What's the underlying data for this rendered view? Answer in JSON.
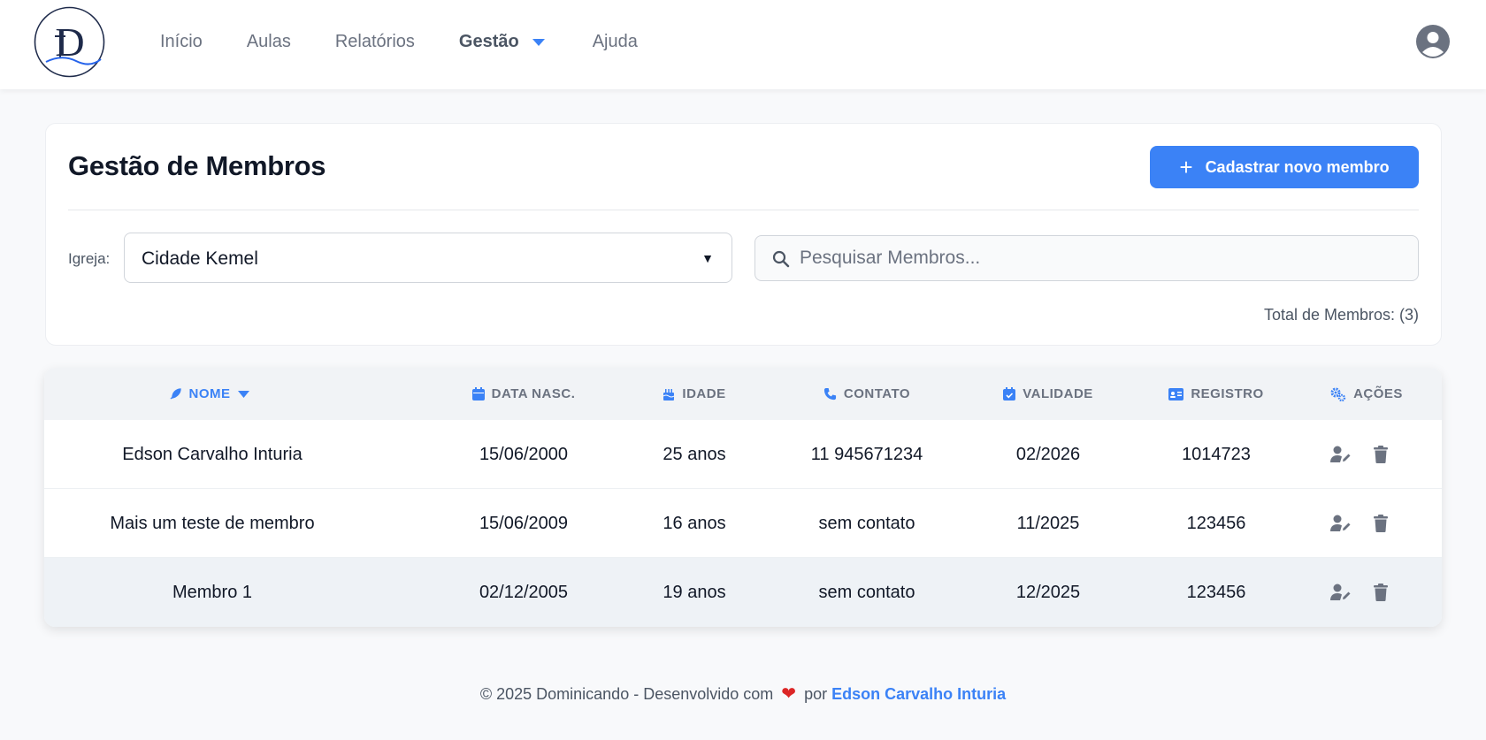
{
  "nav": {
    "items": [
      {
        "label": "Início"
      },
      {
        "label": "Aulas"
      },
      {
        "label": "Relatórios"
      },
      {
        "label": "Gestão"
      },
      {
        "label": "Ajuda"
      }
    ],
    "active_index": 3
  },
  "page": {
    "title": "Gestão de Membros",
    "add_button_label": "Cadastrar novo membro",
    "church_label": "Igreja:",
    "church_selected": "Cidade Kemel",
    "search_placeholder": "Pesquisar Membros...",
    "search_value": "",
    "total_label": "Total de Membros: (3)"
  },
  "table": {
    "columns": [
      {
        "label": "NOME",
        "icon": "feather-icon",
        "sorted": true
      },
      {
        "label": "DATA NASC.",
        "icon": "calendar-icon"
      },
      {
        "label": "IDADE",
        "icon": "cake-icon"
      },
      {
        "label": "CONTATO",
        "icon": "phone-icon"
      },
      {
        "label": "VALIDADE",
        "icon": "calendar-check-icon"
      },
      {
        "label": "REGISTRO",
        "icon": "id-card-icon"
      },
      {
        "label": "AÇÕES",
        "icon": "gears-icon"
      }
    ],
    "rows": [
      {
        "nome": "Edson Carvalho Inturia",
        "nascimento": "15/06/2000",
        "idade": "25 anos",
        "contato": "11 945671234",
        "validade": "02/2026",
        "registro": "1014723"
      },
      {
        "nome": "Mais um teste de membro",
        "nascimento": "15/06/2009",
        "idade": "16 anos",
        "contato": "sem contato",
        "validade": "11/2025",
        "registro": "123456"
      },
      {
        "nome": "Membro 1",
        "nascimento": "02/12/2005",
        "idade": "19 anos",
        "contato": "sem contato",
        "validade": "12/2025",
        "registro": "123456"
      }
    ]
  },
  "footer": {
    "prefix": "© 2025 Dominicando - Desenvolvido com",
    "heart": "❤",
    "middle": "por",
    "author": "Edson Carvalho Inturia"
  },
  "colors": {
    "accent": "#3b82f6",
    "heart": "#dc2626",
    "logo": "#1e2a4a"
  }
}
